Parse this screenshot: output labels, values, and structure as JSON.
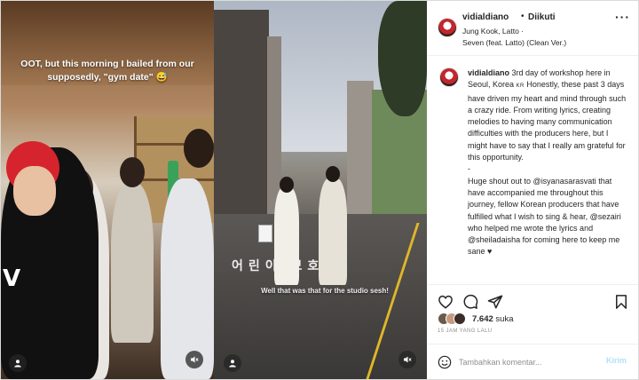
{
  "media": {
    "left_caption": "OOT, but this morning I bailed from our supposedly, \"gym date\" 😅",
    "shirt_letter": "V",
    "right_subtitle": "Well that was that for the studio sesh!",
    "road_text": "어린이 보호"
  },
  "header": {
    "username": "vidialdiano",
    "separator": "•",
    "follow_status": "Diikuti",
    "audio_line1": "Jung Kook, Latto ·",
    "audio_line2": "Seven (feat. Latto) (Clean Ver.)"
  },
  "comment": {
    "username": "vidialdiano",
    "text_a": " 3rd day of workshop here in Seoul, Korea ",
    "flag": "KR",
    "text_b": " Honestly, these past 3 days have driven my heart and mind through such a crazy ride. From writing lyrics, creating melodies to having many communication difficulties with the producers here, but I might have to say that I really am grateful for this opportunity.",
    "dash": "-",
    "text_c": "Huge shout out to @isyanasarasvati that have accompanied me throughout this journey, fellow Korean producers that have fulfilled what I wish to sing & hear, @sezairi who helped me wrote the lyrics and @sheiladaisha for coming here to keep me sane ♥"
  },
  "actions": {
    "likes_count": "7.642",
    "likes_label": "suka",
    "time_ago": "15 JAM YANG LALU"
  },
  "add_comment": {
    "placeholder": "Tambahkan komentar...",
    "post_label": "Kirim"
  },
  "colors": {
    "link_blue": "#b2dffc",
    "muted": "#8e8e8e",
    "text": "#262626"
  }
}
